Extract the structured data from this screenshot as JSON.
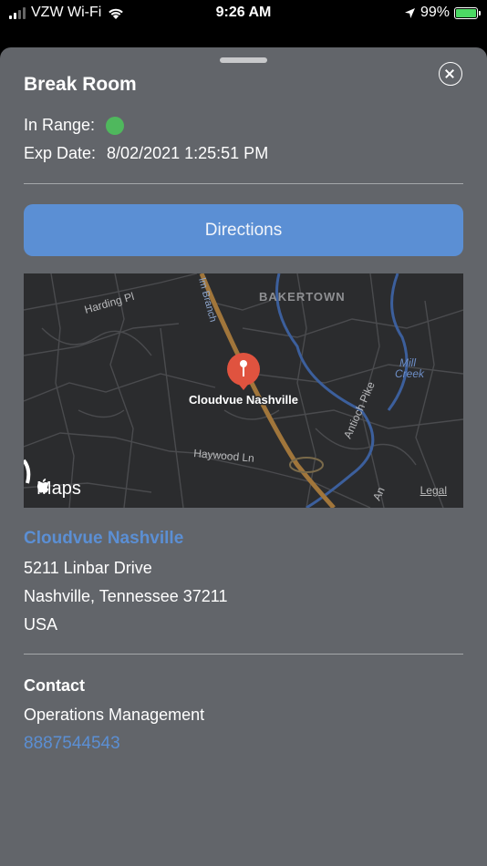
{
  "status": {
    "carrier": "VZW Wi-Fi",
    "time": "9:26 AM",
    "battery": "99%"
  },
  "card": {
    "title": "Break Room",
    "in_range_label": "In Range:",
    "exp_date_label": "Exp Date:",
    "exp_date_value": "8/02/2021 1:25:51 PM",
    "in_range_color": "#4fb85d"
  },
  "directions_label": "Directions",
  "map": {
    "labels": {
      "harding": "Harding Pl",
      "bakertown": "BAKERTOWN",
      "branch": "lm Branch",
      "mill": "Mill",
      "creek": "Creek",
      "antioch": "Antioch Pike",
      "haywood": "Haywood Ln",
      "pin": "Cloudvue Nashville",
      "edge": "An"
    },
    "logo": "Maps",
    "legal": "Legal"
  },
  "location": {
    "name": "Cloudvue Nashville",
    "street": "5211 Linbar Drive",
    "city": "Nashville, Tennessee 37211",
    "country": "USA"
  },
  "contact": {
    "heading": "Contact",
    "name": "Operations Management",
    "phone": "8887544543"
  },
  "colors": {
    "accent": "#5b8fd4",
    "sheet": "#62656a",
    "pin": "#e0533f"
  }
}
